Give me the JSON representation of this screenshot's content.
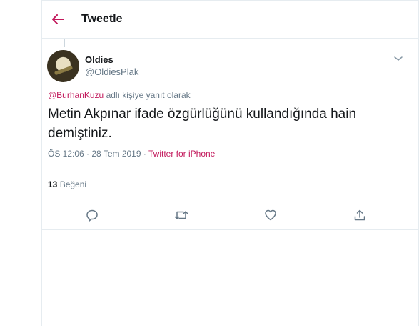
{
  "header": {
    "title": "Tweetle"
  },
  "tweet": {
    "author_name": "Oldies",
    "author_handle": "@OldiesPlak",
    "reply_mention": "@BurhanKuzu",
    "reply_suffix": " adlı kişiye yanıt olarak",
    "text": "Metin Akpınar ifade özgürlüğünü kullandığında hain demiştiniz.",
    "timestamp": "ÖS 12:06 · 28 Tem 2019 · ",
    "source": "Twitter for iPhone",
    "like_count": "13",
    "like_label": " Beğeni"
  },
  "actions": [
    {
      "icon": "reply-icon"
    },
    {
      "icon": "retweet-icon"
    },
    {
      "icon": "like-icon"
    },
    {
      "icon": "share-icon"
    }
  ],
  "colors": {
    "accent": "#c2185b",
    "muted": "#657786",
    "divider": "#e6ecf0"
  }
}
